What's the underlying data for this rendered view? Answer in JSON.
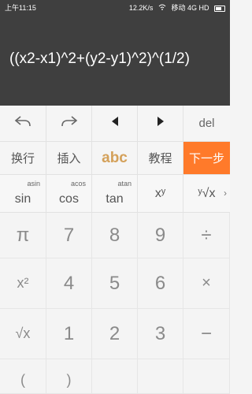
{
  "status": {
    "time": "上午11:15",
    "speed": "12.2K/s",
    "carrier": "移动 4G HD"
  },
  "display": {
    "expression": "((x2-x1)^2+(y2-y1)^2)^(1/2)"
  },
  "toolbar": {
    "del": "del"
  },
  "modes": {
    "newline": "换行",
    "insert": "插入",
    "abc": "abc",
    "tutorial": "教程",
    "next": "下一步"
  },
  "functions": {
    "sin": "sin",
    "asin": "asin",
    "cos": "cos",
    "acos": "acos",
    "tan": "tan",
    "atan": "atan",
    "pow": "xʸ",
    "root": "ʸ√x"
  },
  "keypad": {
    "r1": [
      "π",
      "7",
      "8",
      "9",
      "÷"
    ],
    "r2": [
      "x²",
      "4",
      "5",
      "6",
      "×"
    ],
    "r3": [
      "√x",
      "1",
      "2",
      "3",
      "−"
    ],
    "r4": [
      "(",
      ")"
    ]
  }
}
